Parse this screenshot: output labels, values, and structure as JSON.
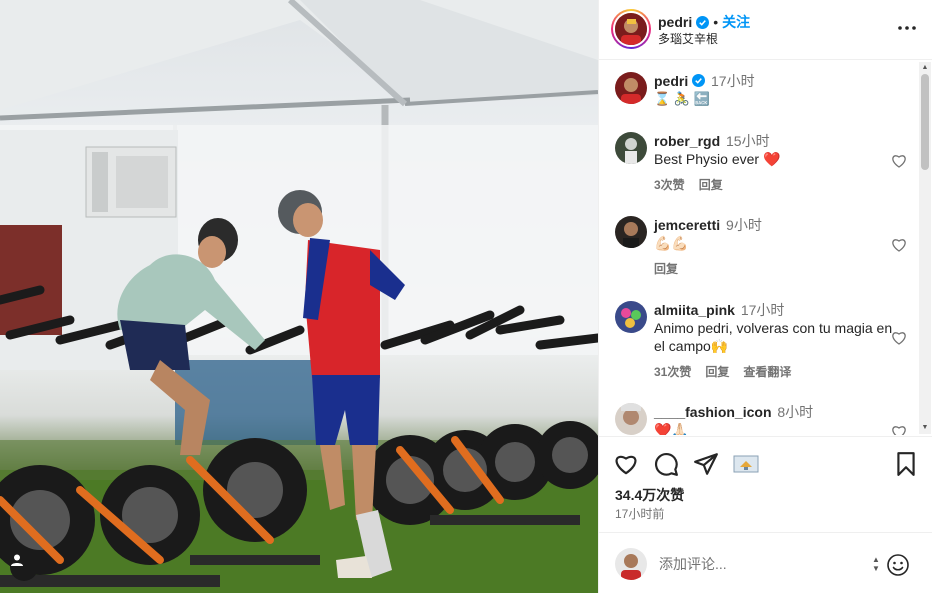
{
  "post": {
    "username": "pedri",
    "follow_label": "关注",
    "location": "多瑙艾辛根",
    "separator": "•"
  },
  "caption": {
    "username": "pedri",
    "time": "17小时",
    "emojis": "⌛ 🚴 🔙"
  },
  "comments": [
    {
      "username": "rober_rgd",
      "time": "15小时",
      "text": "Best Physio ever ❤️",
      "likes": "3次赞",
      "reply": "回复",
      "translate": ""
    },
    {
      "username": "jemceretti",
      "time": "9小时",
      "text": "💪🏻💪🏻",
      "likes": "",
      "reply": "回复",
      "translate": ""
    },
    {
      "username": "almiita_pink",
      "time": "17小时",
      "text": "Animo pedri, volveras con tu magia en el campo🙌",
      "likes": "31次赞",
      "reply": "回复",
      "translate": "查看翻译"
    },
    {
      "username": "____fashion_icon",
      "time": "8小时",
      "text": "❤️🙏🏻",
      "likes": "",
      "reply": "",
      "translate": ""
    }
  ],
  "stats": {
    "likes": "34.4万次赞",
    "post_time": "17小时前"
  },
  "composer": {
    "placeholder": "添加评论..."
  },
  "icons": {
    "like": "heart-icon",
    "comment": "comment-icon",
    "share": "share-icon",
    "gif": "sticker-icon",
    "save": "bookmark-icon",
    "more": "more-icon",
    "emoji": "emoji-icon",
    "verified": "verified-badge-icon",
    "user_tag": "user-tag-icon"
  },
  "colors": {
    "accent": "#0095f6",
    "text": "#262626",
    "muted": "#737373",
    "heart": "#ed4956",
    "border": "#efefef"
  }
}
